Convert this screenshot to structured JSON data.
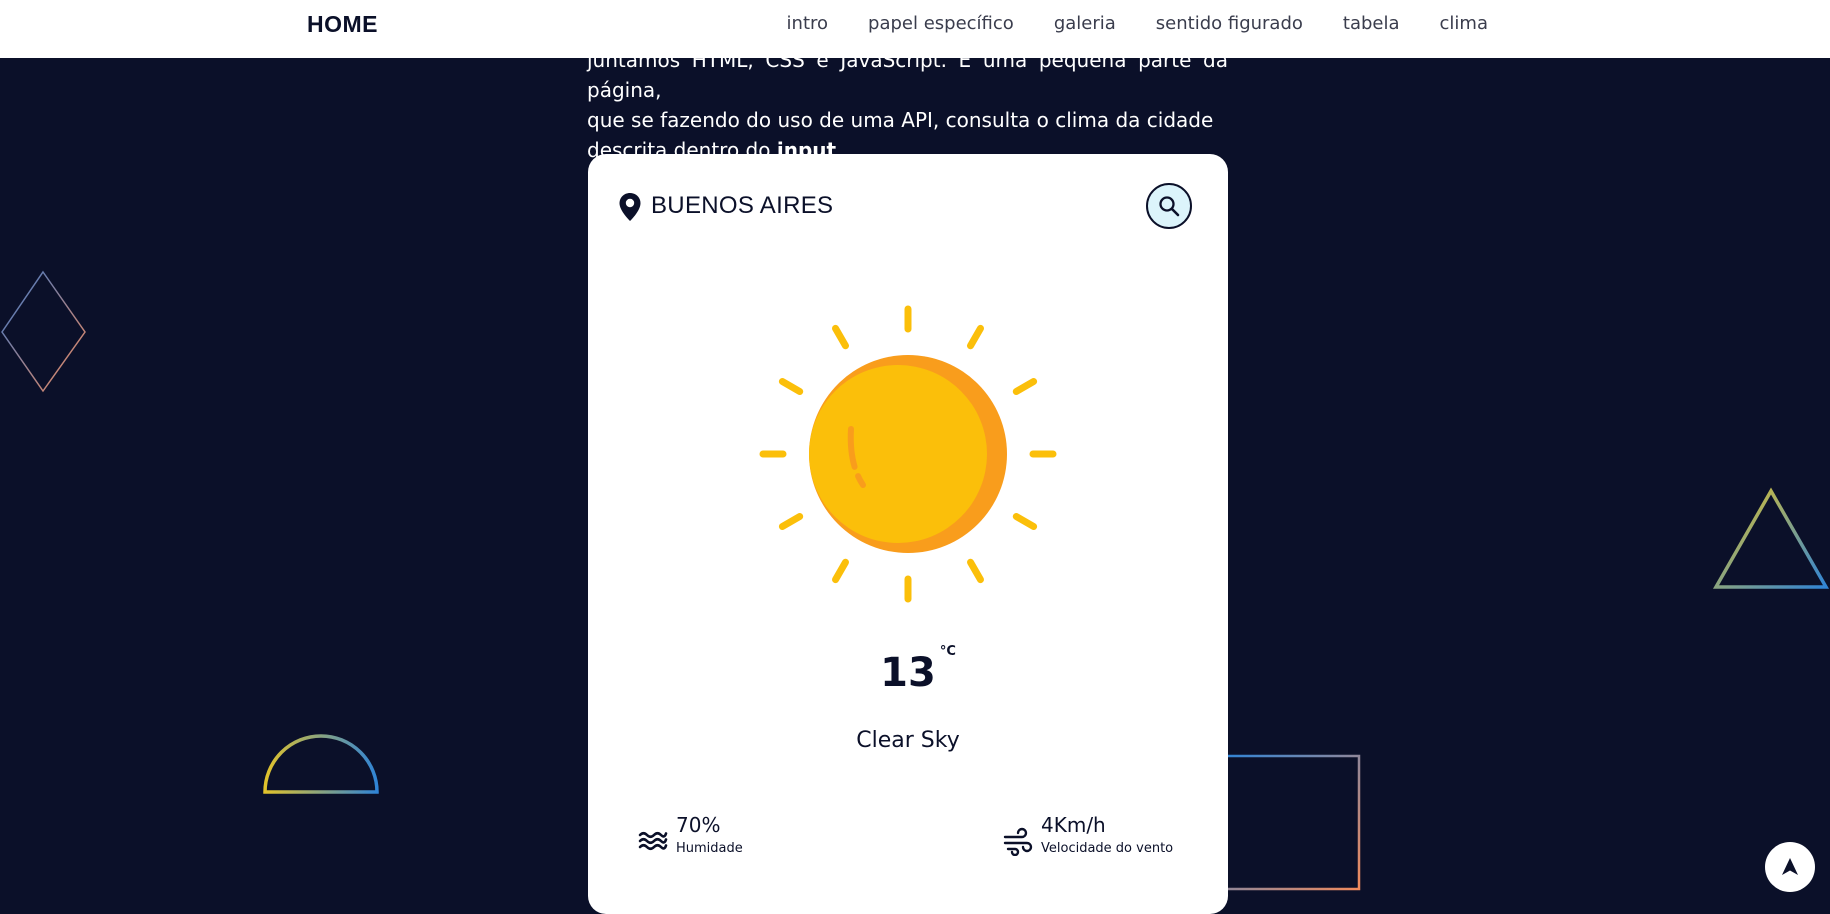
{
  "nav": {
    "brand": "HOME",
    "links": [
      "intro",
      "papel específico",
      "galeria",
      "sentido figurado",
      "tabela",
      "clima"
    ]
  },
  "intro": {
    "line1": "juntamos HTML, CSS e JavaScript. É uma pequena parte da página,",
    "line2": "que se fazendo do uso de uma API, consulta o clima da cidade",
    "line3_prefix": "descrita dentro do ",
    "line3_bold": "input",
    "line3_suffix": "."
  },
  "weather": {
    "city": "BUENOS AIRES",
    "temperature": "13",
    "unit": "°C",
    "description": "Clear Sky",
    "humidity_value": "70%",
    "humidity_label": "Humidade",
    "wind_value": "4Km/h",
    "wind_label": "Velocidade do vento"
  },
  "colors": {
    "background": "#0b1029",
    "sun": "#fbbf0a",
    "sun_shade": "#f99d1c",
    "search_bg": "#dcf4fb"
  },
  "icons": {
    "location": "map-pin-icon",
    "search": "search-icon",
    "humidity": "waves-icon",
    "wind": "wind-icon",
    "scroll_top": "arrow-up-icon"
  }
}
